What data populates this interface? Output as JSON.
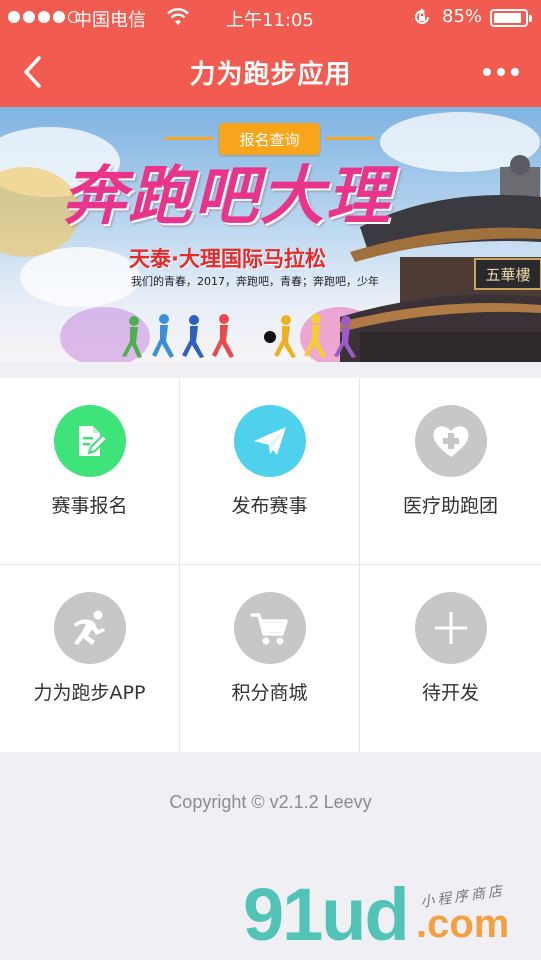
{
  "status_bar": {
    "carrier": "中国电信",
    "time": "上午11:05",
    "battery_percent": "85%",
    "battery_level": 0.85,
    "signal_bars_filled": 4,
    "signal_bars_total": 5
  },
  "nav": {
    "title": "力为跑步应用",
    "back_icon": "chevron-left-icon",
    "more_icon": "more-dots-icon"
  },
  "banner": {
    "badge": "报名查询",
    "title": "奔跑吧大理",
    "subtitle": "天泰·大理国际马拉松",
    "desc": "我们的青春，2017，奔跑吧，青春；奔跑吧，少年",
    "temple_sign": "五華樓",
    "page_count": 1,
    "active_page": 1
  },
  "grid": [
    {
      "label": "赛事报名",
      "icon": "edit-document-icon",
      "color": "#3ee37a"
    },
    {
      "label": "发布赛事",
      "icon": "paper-plane-icon",
      "color": "#4dd1ec"
    },
    {
      "label": "医疗助跑团",
      "icon": "heart-plus-icon",
      "color": "#c7c7c7"
    },
    {
      "label": "力为跑步APP",
      "icon": "runner-icon",
      "color": "#c7c7c7"
    },
    {
      "label": "积分商城",
      "icon": "cart-icon",
      "color": "#c7c7c7"
    },
    {
      "label": "待开发",
      "icon": "plus-icon",
      "color": "#c7c7c7"
    }
  ],
  "footer": {
    "copyright": "Copyright © v2.1.2 Leevy"
  },
  "watermark": {
    "brand": "91ud",
    "domain_suffix": ".com",
    "tagline": "小程序商店"
  },
  "colors": {
    "primary": "#f25b4f",
    "page_bg": "#efeff4",
    "badge": "#f8a51b"
  }
}
